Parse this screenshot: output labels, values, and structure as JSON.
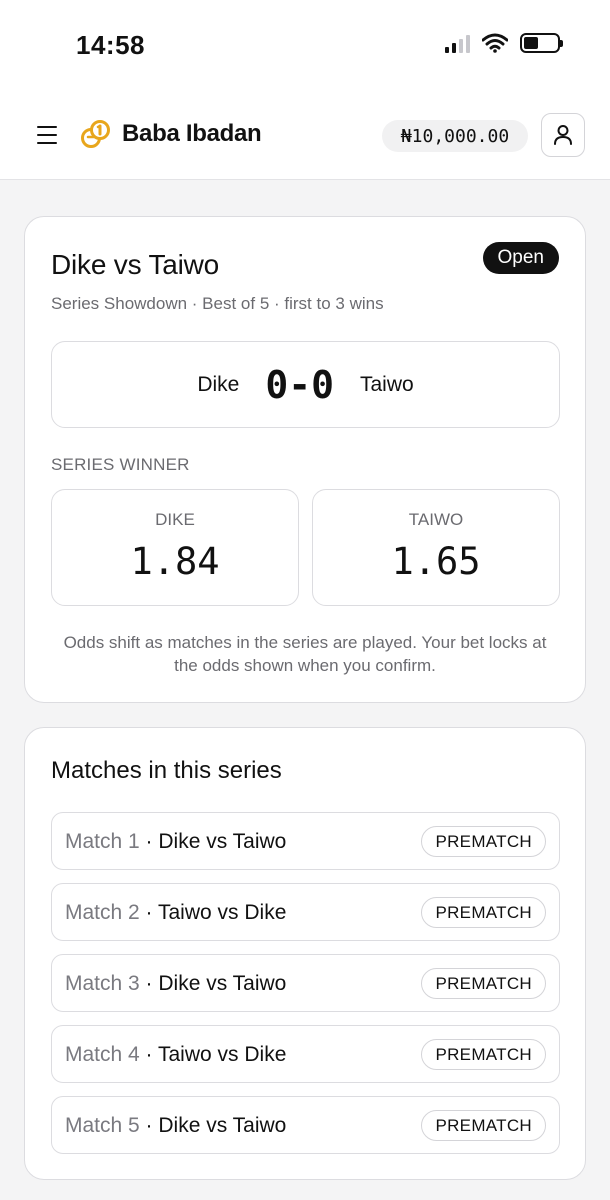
{
  "status_bar": {
    "time": "14:58"
  },
  "header": {
    "brand": "Baba Ibadan",
    "balance": "₦10,000.00",
    "colors": {
      "logo": "#e8a61c"
    }
  },
  "series": {
    "title": "Dike vs Taiwo",
    "status": "Open",
    "subtitle": "Series Showdown · Best of 5 · first to 3 wins",
    "score": {
      "team_a": "Dike",
      "value": "0-0",
      "team_b": "Taiwo"
    },
    "winner_label": "SERIES WINNER",
    "odds": [
      {
        "team": "DIKE",
        "value": "1.84"
      },
      {
        "team": "TAIWO",
        "value": "1.65"
      }
    ],
    "note": "Odds shift as matches in the series are played. Your bet locks at the odds shown when you confirm."
  },
  "matches": {
    "title": "Matches in this series",
    "items": [
      {
        "num": "Match 1",
        "pair": "Dike vs Taiwo",
        "status": "PREMATCH"
      },
      {
        "num": "Match 2",
        "pair": "Taiwo vs Dike",
        "status": "PREMATCH"
      },
      {
        "num": "Match 3",
        "pair": "Dike vs Taiwo",
        "status": "PREMATCH"
      },
      {
        "num": "Match 4",
        "pair": "Taiwo vs Dike",
        "status": "PREMATCH"
      },
      {
        "num": "Match 5",
        "pair": "Dike vs Taiwo",
        "status": "PREMATCH"
      }
    ]
  }
}
